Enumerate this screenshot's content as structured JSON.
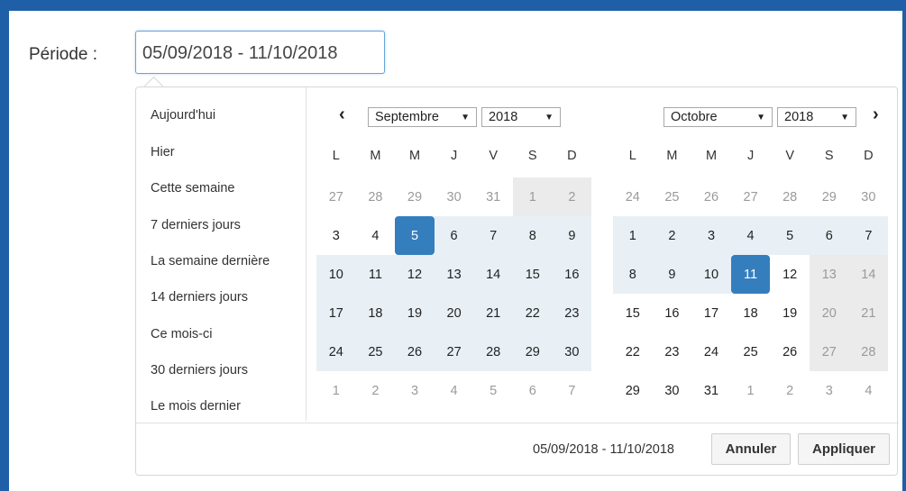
{
  "field": {
    "label": "Période :",
    "value": "05/09/2018 - 11/10/2018"
  },
  "ranges": [
    "Aujourd'hui",
    "Hier",
    "Cette semaine",
    "7 derniers jours",
    "La semaine dernière",
    "14 derniers jours",
    "Ce mois-ci",
    "30 derniers jours",
    "Le mois dernier"
  ],
  "nav": {
    "prev": "‹",
    "next": "›"
  },
  "weekdays": [
    "L",
    "M",
    "M",
    "J",
    "V",
    "S",
    "D"
  ],
  "left_calendar": {
    "month": "Septembre",
    "year": "2018",
    "weeks": [
      [
        [
          "27",
          "off"
        ],
        [
          "28",
          "off"
        ],
        [
          "29",
          "off"
        ],
        [
          "30",
          "off"
        ],
        [
          "31",
          "off"
        ],
        [
          "1",
          "offwk"
        ],
        [
          "2",
          "offwk"
        ]
      ],
      [
        [
          "3",
          "norm"
        ],
        [
          "4",
          "norm"
        ],
        [
          "5",
          "active"
        ],
        [
          "6",
          "inrange"
        ],
        [
          "7",
          "inrange"
        ],
        [
          "8",
          "inrange"
        ],
        [
          "9",
          "inrange"
        ]
      ],
      [
        [
          "10",
          "inrange"
        ],
        [
          "11",
          "inrange"
        ],
        [
          "12",
          "inrange"
        ],
        [
          "13",
          "inrange"
        ],
        [
          "14",
          "inrange"
        ],
        [
          "15",
          "inrange"
        ],
        [
          "16",
          "inrange"
        ]
      ],
      [
        [
          "17",
          "inrange"
        ],
        [
          "18",
          "inrange"
        ],
        [
          "19",
          "inrange"
        ],
        [
          "20",
          "inrange"
        ],
        [
          "21",
          "inrange"
        ],
        [
          "22",
          "inrange"
        ],
        [
          "23",
          "inrange"
        ]
      ],
      [
        [
          "24",
          "inrange"
        ],
        [
          "25",
          "inrange"
        ],
        [
          "26",
          "inrange"
        ],
        [
          "27",
          "inrange"
        ],
        [
          "28",
          "inrange"
        ],
        [
          "29",
          "inrange"
        ],
        [
          "30",
          "inrange"
        ]
      ],
      [
        [
          "1",
          "off"
        ],
        [
          "2",
          "off"
        ],
        [
          "3",
          "off"
        ],
        [
          "4",
          "off"
        ],
        [
          "5",
          "off"
        ],
        [
          "6",
          "off"
        ],
        [
          "7",
          "off"
        ]
      ]
    ]
  },
  "right_calendar": {
    "month": "Octobre",
    "year": "2018",
    "weeks": [
      [
        [
          "24",
          "off"
        ],
        [
          "25",
          "off"
        ],
        [
          "26",
          "off"
        ],
        [
          "27",
          "off"
        ],
        [
          "28",
          "off"
        ],
        [
          "29",
          "off"
        ],
        [
          "30",
          "off"
        ]
      ],
      [
        [
          "1",
          "inrange"
        ],
        [
          "2",
          "inrange"
        ],
        [
          "3",
          "inrange"
        ],
        [
          "4",
          "inrange"
        ],
        [
          "5",
          "inrange"
        ],
        [
          "6",
          "inrange"
        ],
        [
          "7",
          "inrange"
        ]
      ],
      [
        [
          "8",
          "inrange"
        ],
        [
          "9",
          "inrange"
        ],
        [
          "10",
          "inrange"
        ],
        [
          "11",
          "active"
        ],
        [
          "12",
          "norm"
        ],
        [
          "13",
          "wk"
        ],
        [
          "14",
          "wk"
        ]
      ],
      [
        [
          "15",
          "norm"
        ],
        [
          "16",
          "norm"
        ],
        [
          "17",
          "norm"
        ],
        [
          "18",
          "norm"
        ],
        [
          "19",
          "norm"
        ],
        [
          "20",
          "wk"
        ],
        [
          "21",
          "wk"
        ]
      ],
      [
        [
          "22",
          "norm"
        ],
        [
          "23",
          "norm"
        ],
        [
          "24",
          "norm"
        ],
        [
          "25",
          "norm"
        ],
        [
          "26",
          "norm"
        ],
        [
          "27",
          "wk"
        ],
        [
          "28",
          "wk"
        ]
      ],
      [
        [
          "29",
          "norm"
        ],
        [
          "30",
          "norm"
        ],
        [
          "31",
          "norm"
        ],
        [
          "1",
          "off"
        ],
        [
          "2",
          "off"
        ],
        [
          "3",
          "off"
        ],
        [
          "4",
          "off"
        ]
      ]
    ]
  },
  "footer": {
    "range_text": "05/09/2018 - 11/10/2018",
    "cancel_label": "Annuler",
    "apply_label": "Appliquer"
  },
  "colors": {
    "accent": "#357ebd",
    "range_bg": "#e8f0f5",
    "weekend_bg": "#ebebeb",
    "frame": "#1f5fa8"
  }
}
